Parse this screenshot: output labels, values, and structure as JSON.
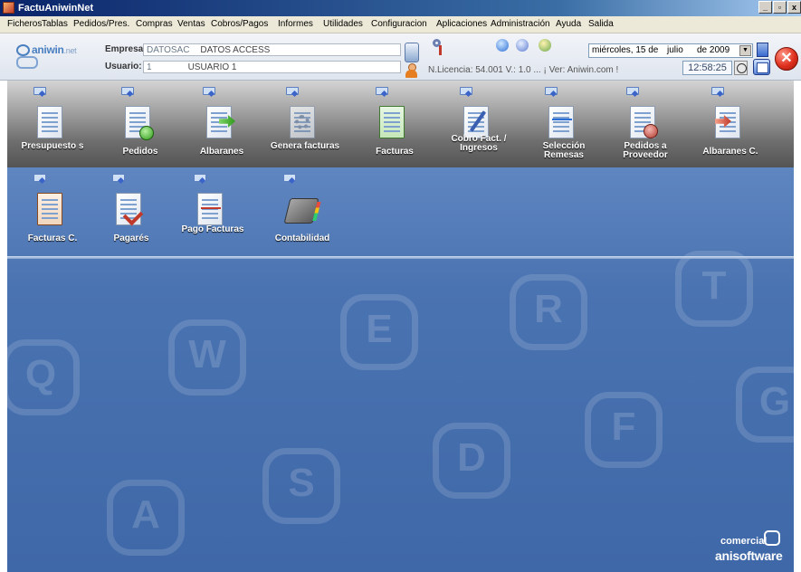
{
  "window": {
    "title": "FactuAniwinNet",
    "controls": [
      "_",
      "▫",
      "x"
    ]
  },
  "menu": [
    "Ficheros",
    "Tablas",
    "Pedidos/Pres.",
    "Compras",
    "Ventas",
    "Cobros/Pagos",
    "Informes",
    "Utilidades",
    "Configuracion",
    "Aplicaciones",
    "Administración",
    "Ayuda",
    "Salida"
  ],
  "logo": {
    "text": "aniwin",
    "suffix": ".net"
  },
  "info": {
    "empresa_label": "Empresa:",
    "empresa_code": "DATOSAC",
    "empresa_name": "DATOS ACCESS",
    "usuario_label": "Usuario:",
    "usuario_code": "1",
    "usuario_name": "USUARIO 1",
    "licencia": "N.Licencia: 54.001  V.: 1.0 ... ¡ Ver: Aniwin.com !"
  },
  "date": {
    "weekday": "miércoles, 15 de",
    "month": "julio",
    "year": "de 2009",
    "time": "12:58:25"
  },
  "tiles_row1": [
    {
      "label": "Presupuesto s"
    },
    {
      "label": "Pedidos"
    },
    {
      "label": "Albaranes"
    },
    {
      "label": "Genera facturas"
    },
    {
      "label": "Facturas"
    },
    {
      "label": "Cobro Fact. / Ingresos"
    },
    {
      "label": "Selección Remesas"
    },
    {
      "label": "Pedidos a Proveedor"
    },
    {
      "label": "Albaranes C."
    }
  ],
  "tiles_row2": [
    {
      "label": "Facturas C."
    },
    {
      "label": "Pagarés"
    },
    {
      "label": "Pago Facturas"
    },
    {
      "label": "Contabilidad"
    }
  ],
  "keys": [
    "Q",
    "W",
    "E",
    "R",
    "T",
    "A",
    "S",
    "D",
    "F",
    "G"
  ],
  "brand": {
    "line1": "comercial",
    "line2": "anisoftware"
  },
  "colors": {
    "title_bar": "#0a246a",
    "blue_panel": "#4a73b1",
    "gray_panel": "#a2a2a2",
    "exit": "#e0301e"
  }
}
